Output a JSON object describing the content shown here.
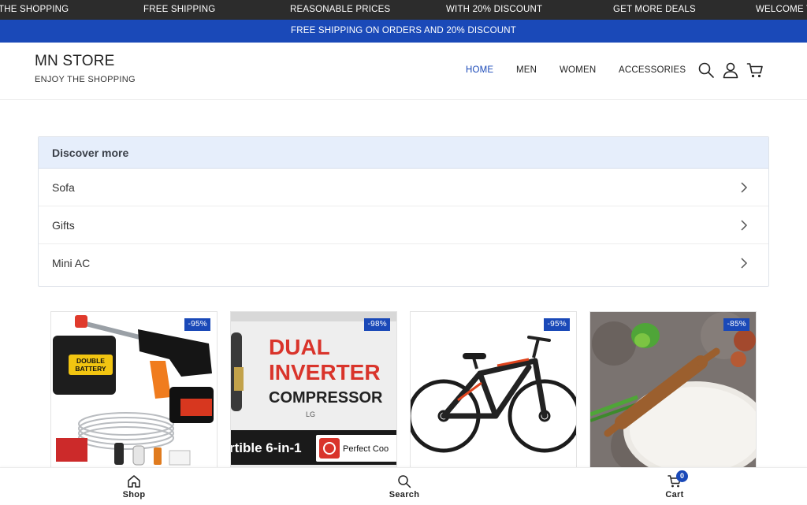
{
  "marquee": [
    "THE SHOPPING",
    "FREE SHIPPING",
    "REASONABLE PRICES",
    "WITH 20% DISCOUNT",
    "GET MORE DEALS",
    "WELCOME THE"
  ],
  "promo_text": "FREE SHIPPING ON ORDERS AND 20% DISCOUNT",
  "brand": {
    "title": "MN STORE",
    "subtitle": "ENJOY THE SHOPPING"
  },
  "nav": [
    {
      "label": "HOME",
      "active": true
    },
    {
      "label": "MEN",
      "active": false
    },
    {
      "label": "WOMEN",
      "active": false
    },
    {
      "label": "ACCESSORIES",
      "active": false
    }
  ],
  "header_icons": [
    "search-icon",
    "user-icon",
    "cart-icon"
  ],
  "discover": {
    "title": "Discover more",
    "items": [
      "Sofa",
      "Gifts",
      "Mini AC"
    ]
  },
  "products": [
    {
      "discount": "-95%",
      "image": "cordless-pressure-washer",
      "image_text": "DOUBLE BATTERY"
    },
    {
      "discount": "-98%",
      "image": "inverter-ac-banner",
      "image_text": [
        "DUAL",
        "INVERTER",
        "COMPRESSOR",
        "LG",
        "rtible 6-in-1",
        "Perfect Coo"
      ]
    },
    {
      "discount": "-95%",
      "image": "mountain-bicycle"
    },
    {
      "discount": "-85%",
      "image": "rolling-pin-board"
    }
  ],
  "bottom_nav": {
    "shop": "Shop",
    "search": "Search",
    "cart": "Cart",
    "cart_count": "0"
  },
  "colors": {
    "accent": "#1a49b8",
    "topbar": "#2c2c2c",
    "discover_header": "#e6eefb"
  }
}
